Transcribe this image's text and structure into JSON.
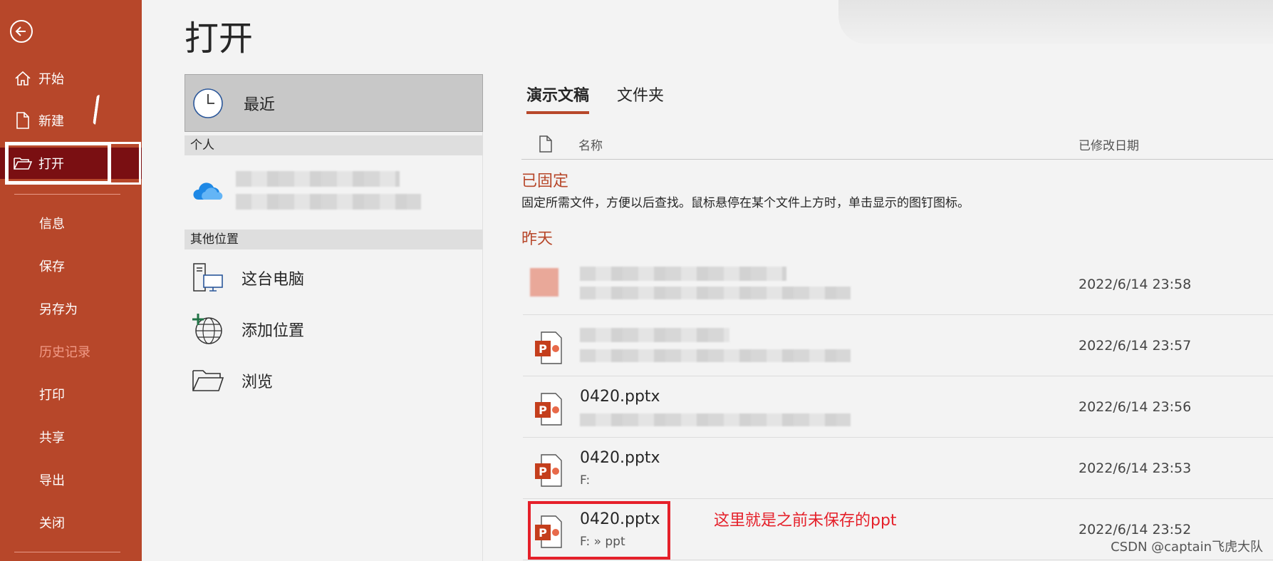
{
  "sidebar": {
    "items": [
      {
        "label": "开始",
        "icon": "home-icon"
      },
      {
        "label": "新建",
        "icon": "new-doc-icon"
      },
      {
        "label": "打开",
        "icon": "folder-open-icon"
      },
      {
        "label": "信息"
      },
      {
        "label": "保存"
      },
      {
        "label": "另存为"
      },
      {
        "label": "历史记录"
      },
      {
        "label": "打印"
      },
      {
        "label": "共享"
      },
      {
        "label": "导出"
      },
      {
        "label": "关闭"
      }
    ]
  },
  "header": {
    "title": "打开"
  },
  "locations": {
    "recent": "最近",
    "personal_group": "个人",
    "other_group": "其他位置",
    "items": [
      {
        "label": "这台电脑",
        "icon": "computer-icon"
      },
      {
        "label": "添加位置",
        "icon": "globe-add-icon"
      },
      {
        "label": "浏览",
        "icon": "folder-icon"
      }
    ]
  },
  "files": {
    "tabs": [
      {
        "label": "演示文稿"
      },
      {
        "label": "文件夹"
      }
    ],
    "col_name": "名称",
    "col_date": "已修改日期",
    "pinned_title": "已固定",
    "pinned_desc": "固定所需文件，方便以后查找。鼠标悬停在某个文件上方时，单击显示的图钉图标。",
    "yesterday_title": "昨天",
    "rows": [
      {
        "name": "",
        "path": "",
        "date": "2022/6/14 23:58"
      },
      {
        "name": "",
        "path": "",
        "date": "2022/6/14 23:57"
      },
      {
        "name": "0420.pptx",
        "path": "",
        "date": "2022/6/14 23:56"
      },
      {
        "name": "0420.pptx",
        "path": "F:",
        "date": "2022/6/14 23:53"
      },
      {
        "name": "0420.pptx",
        "path": "F: » ppt",
        "date": "2022/6/14 23:52"
      }
    ]
  },
  "annotation": "这里就是之前未保存的ppt",
  "watermark": "CSDN @captain飞虎大队",
  "colors": {
    "accent": "#b7472a",
    "active": "#7a0f12",
    "annotation": "#e5202a"
  }
}
